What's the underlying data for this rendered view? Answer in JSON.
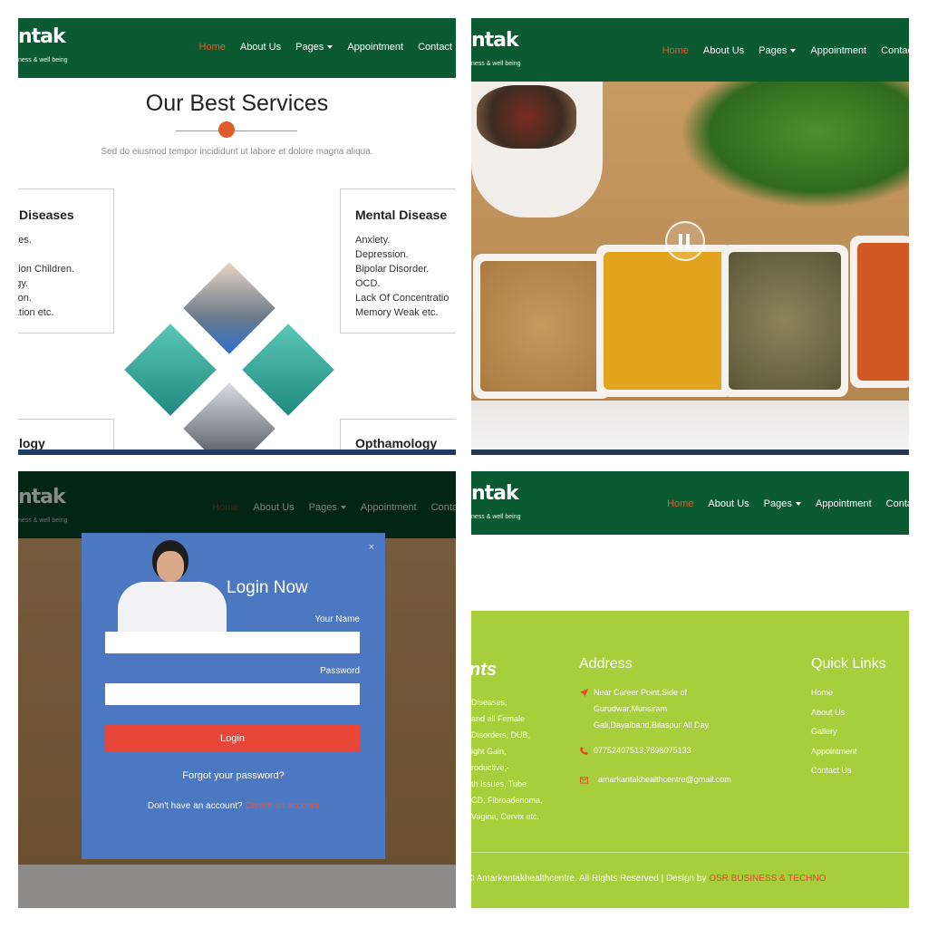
{
  "nav": {
    "logo": "ntak",
    "tagline": "ness & well being",
    "items": [
      "Home",
      "About Us",
      "Pages",
      "Appointment",
      "Contact"
    ],
    "items_short": [
      "Home",
      "About Us",
      "Pages",
      "Appointment",
      "Contac"
    ],
    "items_short3": [
      "Home",
      "About Us",
      "Pages",
      "Appointment",
      "Conta"
    ]
  },
  "services": {
    "title": "Our Best Services",
    "subtitle": "Sed do eiusmod tempor incididunt ut labore et dolore magna aliqua.",
    "left_card": {
      "title": "Diseases",
      "items": [
        "betes.",
        "",
        "dation Children.",
        "lergy.",
        "tation.",
        "rdation etc."
      ]
    },
    "right_card": {
      "title": "Mental Disease",
      "items": [
        "Anxiety.",
        "Depression.",
        "Bipolar Disorder.",
        "OCD.",
        "Lack Of Concentratio",
        "Memory Weak etc."
      ]
    },
    "bottom_left_title": "logy",
    "bottom_right_title": "Opthamology"
  },
  "login": {
    "close": "×",
    "title": "Login Now",
    "name_label": "Your Name",
    "password_label": "Password",
    "button": "Login",
    "forgot": "Forgot your password?",
    "no_account": "Don't have an account?",
    "signup_link": "Create an account"
  },
  "footer": {
    "col1_title": "nts",
    "col1_items": [
      "Diseases,",
      "and all Female",
      "Disorders, DUB,",
      "ight Gain,",
      "roductive;-",
      "th Issues, Tube",
      "CD, Fibroadenoma,",
      "Vagina, Cervix etc."
    ],
    "address_title": "Address",
    "address_lines": [
      "Near Career Point,Side of",
      "Gurudwar,Munsiram",
      "Gali,Dayalband,Bilaspur All Day"
    ],
    "phone": "07752407513,7898075133",
    "email": "amarkantakhealthcentre@gmail.com",
    "links_title": "Quick Links",
    "links": [
      "Home",
      "About Us",
      "Gallery",
      "Appointment",
      "Contact Us"
    ],
    "copyright": "© Amarkantakhealthcentre. All Rights Reserved | Design by",
    "designer": "OSR BUSINESS & TECHNO"
  },
  "colors": {
    "nav_green": "#0b5a32",
    "accent_orange": "#e05a2a",
    "modal_blue": "#4c78c2",
    "login_red": "#e64538",
    "footer_green": "#a6cf3b"
  }
}
